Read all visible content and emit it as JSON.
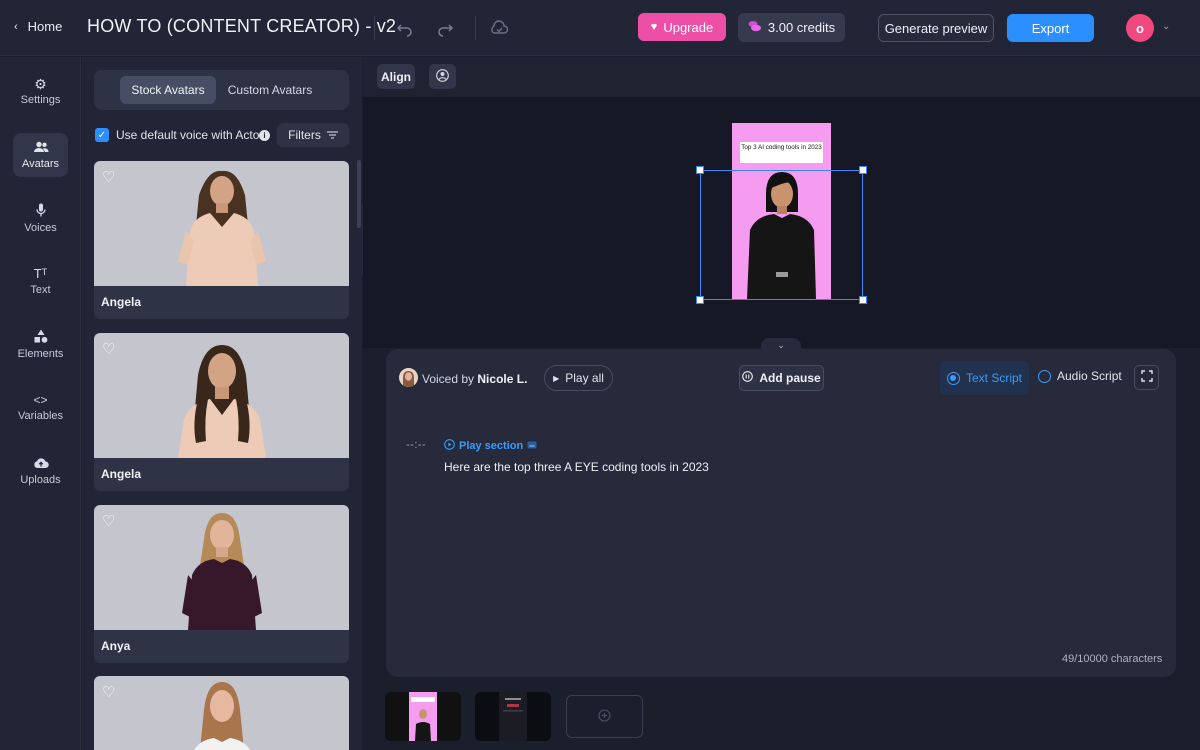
{
  "topbar": {
    "home_label": "Home",
    "project_title": "HOW TO (CONTENT CREATOR) - v2",
    "upgrade_label": "Upgrade",
    "credits_label": "3.00 credits",
    "generate_preview_label": "Generate preview",
    "export_label": "Export",
    "avatar_initial": "o"
  },
  "nav": {
    "items": [
      {
        "label": "Settings",
        "icon": "gear-icon"
      },
      {
        "label": "Avatars",
        "icon": "users-icon"
      },
      {
        "label": "Voices",
        "icon": "microphone-icon"
      },
      {
        "label": "Text",
        "icon": "text-icon"
      },
      {
        "label": "Elements",
        "icon": "shapes-icon"
      },
      {
        "label": "Variables",
        "icon": "code-icon"
      },
      {
        "label": "Uploads",
        "icon": "cloud-upload-icon"
      }
    ],
    "active": "Avatars"
  },
  "avatars_panel": {
    "tabs": [
      "Stock Avatars",
      "Custom Avatars"
    ],
    "active_tab": "Stock Avatars",
    "use_default_voice_label": "Use default voice with Actor",
    "use_default_voice_checked": true,
    "filters_label": "Filters",
    "cards": [
      {
        "name": "Angela"
      },
      {
        "name": "Angela"
      },
      {
        "name": "Anya"
      },
      {
        "name": ""
      }
    ]
  },
  "canvas": {
    "align_label": "Align",
    "caption_text": "Top 3 AI coding tools in 2023"
  },
  "script": {
    "voiced_by_prefix": "Voiced by",
    "voiced_by_name": "Nicole L.",
    "play_all_label": "Play all",
    "add_pause_label": "Add pause",
    "text_script_label": "Text Script",
    "audio_script_label": "Audio Script",
    "selected_mode": "Text Script",
    "timecode": "--:--",
    "play_section_label": "Play section",
    "script_text": "Here are the top three A EYE coding tools in 2023",
    "char_count": "49/10000 characters"
  },
  "colors": {
    "accent": "#2b8fff",
    "upgrade": "#ee4fa6",
    "canvas_bg": "#f59bf0",
    "avatar_bg": "#f1487f"
  }
}
